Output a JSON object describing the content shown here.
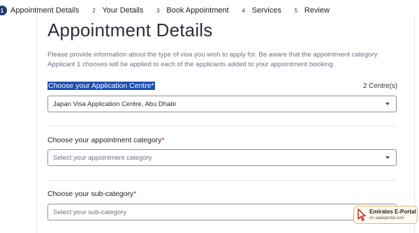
{
  "stepper": {
    "steps": [
      {
        "num": "1",
        "label": "Appointment Details",
        "active": true
      },
      {
        "num": "2",
        "label": "Your Details",
        "active": false
      },
      {
        "num": "3",
        "label": "Book Appointment",
        "active": false
      },
      {
        "num": "4",
        "label": "Services",
        "active": false
      },
      {
        "num": "5",
        "label": "Review",
        "active": false
      }
    ]
  },
  "page": {
    "title": "Appointment Details",
    "intro": "Please provide information about the type of visa you wish to apply for. Be aware that the appointment category Applicant 1 chooses will be applied to each of the applicants added to your appointment booking."
  },
  "form": {
    "centre": {
      "label": "Choose your Application Centre",
      "required_mark": "*",
      "count": "2 Centre(s)",
      "value": "Japan Visa Application Centre, Abu Dhabi"
    },
    "category": {
      "label": "Choose your appointment category",
      "required_mark": "*",
      "placeholder": "Select your appointment category"
    },
    "subcategory": {
      "label": "Choose your sub-category",
      "required_mark": "*",
      "placeholder": "Select your sub-category"
    }
  },
  "watermark": {
    "title": "Emirates E-Portal",
    "url": "on uaeeportal.com"
  },
  "colors": {
    "active_step": "#1e3a6e",
    "selection_highlight": "#1c4fb0",
    "required": "#c81e1e",
    "watermark_border": "#e8b86c",
    "cursor": "#c0392b"
  }
}
